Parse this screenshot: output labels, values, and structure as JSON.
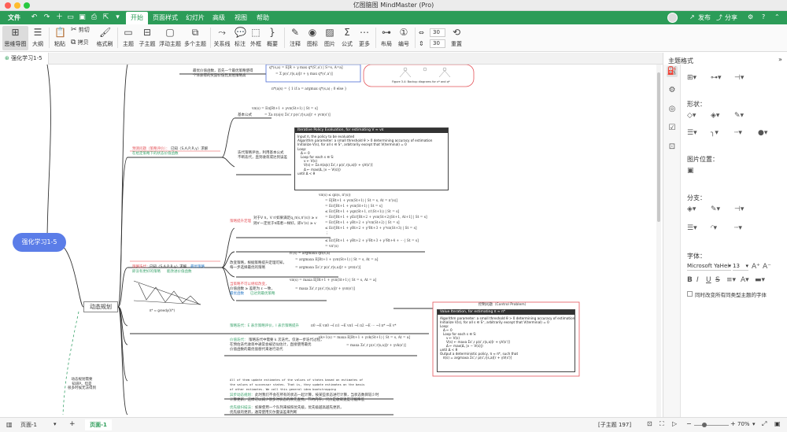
{
  "window": {
    "title": "亿图脑图 MindMaster (Pro)"
  },
  "menubar": {
    "file_label": "文件",
    "tabs": [
      {
        "label": "开始"
      },
      {
        "label": "页面样式"
      },
      {
        "label": "幻灯片"
      },
      {
        "label": "高级"
      },
      {
        "label": "视图"
      },
      {
        "label": "帮助"
      }
    ],
    "publish_label": "发布",
    "share_label": "分享"
  },
  "ribbon": {
    "buttons": [
      {
        "label": "思维导图"
      },
      {
        "label": "大纲"
      },
      {
        "label": "粘贴"
      },
      {
        "label": "剪切"
      },
      {
        "label": "拷贝"
      },
      {
        "label": "格式刷"
      },
      {
        "label": "主题"
      },
      {
        "label": "子主题"
      },
      {
        "label": "浮动主题"
      },
      {
        "label": "多个主题"
      },
      {
        "label": "关系线"
      },
      {
        "label": "标注"
      },
      {
        "label": "外框"
      },
      {
        "label": "概要"
      },
      {
        "label": "注释"
      },
      {
        "label": "图标"
      },
      {
        "label": "图片"
      },
      {
        "label": "公式"
      },
      {
        "label": "更多"
      },
      {
        "label": "布局"
      },
      {
        "label": "编号"
      },
      {
        "label": "重置"
      }
    ],
    "spin1": "30",
    "spin2": "30"
  },
  "doc_tab": {
    "label": "强化学习1-5"
  },
  "canvas": {
    "root_topic": "强化学习1-5",
    "dp_topic": "动态规划",
    "dp_note": [
      "动态规划需要",
      "知道P。但是",
      "很多时候无法得到"
    ],
    "policy_eval": {
      "red": "预测问题（策略评价）：",
      "rest": "已知〈S,A,P,R,γ〉求解",
      "green": "在给定策略下的状态价值函数"
    },
    "policy_iter": {
      "red": "策略迭代：",
      "rest": "已知〈S,A,P,R,γ〉求解",
      "blue": "最优策略",
      "green": "即没有更好的策略",
      "green2": "能改进价值函数"
    },
    "basic_formula": "基本公式",
    "iterative_desc": [
      "迭代策略评估，利用基本公式",
      "不断迭代，直到收敛或达到误差"
    ],
    "policy_improve": {
      "red": "策略提升定理",
      "rest": "对于V π，V π'如果满足q_π(s,π'(s)) ≥ v",
      "rest2": "则π'一定优于π或者一样好，即v'(s) ≥ v"
    },
    "improve_desc": [
      "改变策略，根据策略提升定理可知，",
      "每一步选择最优的策略"
    ],
    "optimal_red": [
      "当策略不可以继续改变，",
      "价值函数 ≥ 差距为 ε 一致，",
      "此时最优策略"
    ],
    "optimal_green": [
      "已达到最优策略",
      "即为贝尔曼最优方程"
    ],
    "optimal_blue": "最优函数",
    "vi_line": "策略迭代：E 表示策略评价，I 表示策略提升",
    "value_iter": {
      "green": "价值迭代：",
      "rest1": "策略迭代中需要 k 次迭代，仅进一步迭代过程，",
      "rest2": "在预估迭代收敛中通常会被近似估计，直接使用最优",
      "rest3": "价值函数的最优值替代来进行迭代"
    },
    "control_title": "控制问题（Control Problem）",
    "bottom_note": [
      "All of them update estimates of the values of states based on estimates of",
      "the values of successor states. That is, they update estimates on the basis",
      "of other estimates. We call this general idea bootstrapping"
    ],
    "async_green": "异步动态规划：",
    "async_text": [
      "此时我们不会在所有的状态一起计算，按某些状态进行计算，当状态数目较少时",
      "计算更新，这样可以减少很多对状态的原先查找，节约内存，代价是收敛速度可能降低"
    ],
    "prio_green": "优先级扫描法：",
    "prio_text": [
      "如果使用一个队列来按照优先级，优先级越高越先更新，",
      "优先级的更新，通常使用贝尔曼误差来判断"
    ],
    "iter_policy_box": {
      "title": "Iterative Policy Evaluation, for estimating V ≈ vπ",
      "lines": [
        "Input π, the policy to be evaluated",
        "Algorithm parameter: a small threshold θ > 0 determining accuracy of estimation",
        "Initialize V(s), for all s ∈ S⁺, arbitrarily except that V(terminal) = 0",
        "",
        "Loop:",
        "   Δ ← 0",
        "   Loop for each s ∈ S:",
        "      v ← V(s)",
        "      V(s) ← Σa π(a|s) Σs',r p(s',r|s,a)[r + γV(s')]",
        "      Δ ← max(Δ, |v − V(s)|)",
        "until Δ < θ"
      ]
    },
    "value_iter_box": {
      "title": "Value Iteration, for estimating π ≈ π*",
      "lines": [
        "Algorithm parameter: a small threshold θ > 0 determining accuracy of estimation",
        "Initialize V(s), for all s ∈ S⁺, arbitrarily except that V(terminal) = 0",
        "",
        "Loop:",
        "   Δ ← 0",
        "   Loop for each s ∈ S:",
        "      v ← V(s)",
        "      V(s) ← maxa Σs',r p(s',r|s,a)[r + γV(s')]",
        "      Δ ← max(Δ, |v − V(s)|)",
        "until Δ < θ",
        "",
        "Output a deterministic policy, π ≈ π*, such that",
        "   π(s) = argmaxa Σs',r p(s',r|s,a)[r + γV(s')]"
      ]
    },
    "top_note": [
      "最优价值函数，首先一个最优策略使得",
      "个体获得的奖励价值比其他策略高"
    ],
    "backup_caption": "Figure 3.4: Backup diagrams for v* and q*",
    "policy_arrow_label": "π* ≈ greedy(V*)"
  },
  "panel": {
    "title": "主题格式",
    "shape_label": "形状：",
    "image_pos_label": "图片位置：",
    "branch_label": "分支：",
    "font_label": "字体：",
    "font_name": "Microsoft YaHei",
    "font_size": "13",
    "checkbox_label": "同时改变所有同类型主题的字体"
  },
  "status": {
    "page_select": "页面-1",
    "active_page": "页面-1",
    "topic_count": "[子主题 197]",
    "zoom": "70%"
  },
  "colors": {
    "brand_green": "#2c9c58",
    "root_blue": "#5b7de8",
    "red_text": "#e4545a",
    "green_text": "#3aa36b"
  }
}
